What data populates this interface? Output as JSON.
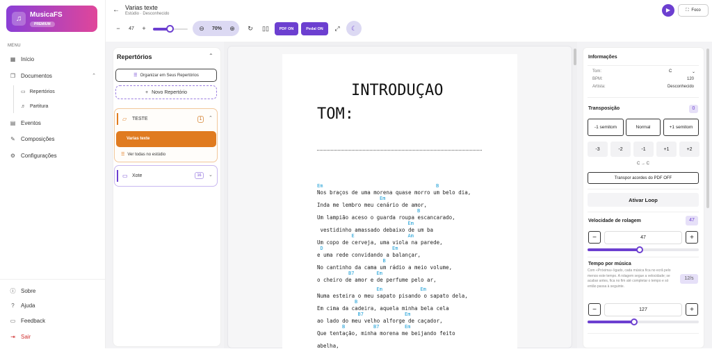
{
  "brand": {
    "name": "MusicaFS",
    "badge": "PREMIUM"
  },
  "sidebar": {
    "menu_label": "MENU",
    "items": [
      {
        "label": "Início",
        "icon": "grid-icon"
      },
      {
        "label": "Documentos",
        "icon": "documents-icon"
      },
      {
        "label": "Repertórios",
        "icon": "folder-icon"
      },
      {
        "label": "Partitura",
        "icon": "music-sheet-icon"
      },
      {
        "label": "Eventos",
        "icon": "calendar-icon"
      },
      {
        "label": "Composições",
        "icon": "compose-icon"
      },
      {
        "label": "Configurações",
        "icon": "gear-icon"
      }
    ],
    "bottom": [
      {
        "label": "Sobre",
        "icon": "info-icon"
      },
      {
        "label": "Ajuda",
        "icon": "help-icon"
      },
      {
        "label": "Feedback",
        "icon": "chat-icon"
      },
      {
        "label": "Sair",
        "icon": "logout-icon"
      }
    ]
  },
  "header": {
    "title": "Varias texte",
    "subtitle": "Estúdio · Desconhecido",
    "focus_label": "Foco"
  },
  "toolbar": {
    "font_size": "47",
    "font_size_level": 0.47,
    "zoom": "70%",
    "pdf_label": "PDF ON",
    "pedal_label": "Pedal ON"
  },
  "repertorios": {
    "title": "Repertórios",
    "organize_label": "Organizar em Seus Repertórios",
    "new_label": "Novo Repertório",
    "groups": [
      {
        "name": "TESTE",
        "count": "1",
        "songs": [
          "Varias texte"
        ],
        "see_all": "Ver todas no estúdio"
      },
      {
        "name": "Xote",
        "count": "16"
      }
    ]
  },
  "document": {
    "heading1": "INTRODUÇAO",
    "heading2": "TOM:",
    "lines": [
      {
        "chords": [
          {
            "t": "Em",
            "c": 0
          },
          {
            "t": "B",
            "c": 38
          }
        ],
        "text": "Nos braços de uma morena quase morro um belo dia,"
      },
      {
        "chords": [
          {
            "t": "Em",
            "c": 20
          }
        ],
        "text": "Inda me lembro meu cenário de amor,"
      },
      {
        "chords": [
          {
            "t": "B",
            "c": 32
          }
        ],
        "text": "Um lampião aceso o guarda roupa escancarado,"
      },
      {
        "chords": [
          {
            "t": "Em",
            "c": 29
          }
        ],
        "text": " vestidinho amassado debaixo de um ba"
      },
      {
        "chords": [
          {
            "t": "E",
            "c": 11
          },
          {
            "t": "Am",
            "c": 29
          }
        ],
        "text": "Um copo de cerveja, uma viola na parede,"
      },
      {
        "chords": [
          {
            "t": "D",
            "c": 1
          },
          {
            "t": "Em",
            "c": 24
          }
        ],
        "text": "e uma rede convidando a balançar,"
      },
      {
        "chords": [
          {
            "t": "B",
            "c": 21
          }
        ],
        "text": "No cantinho da cama um rádio a meio volume,"
      },
      {
        "chords": [
          {
            "t": "B7",
            "c": 10
          },
          {
            "t": "Em",
            "c": 19
          }
        ],
        "text": "o cheiro de amor e de perfume pelo ar,"
      },
      {
        "chords": [
          {
            "t": "Em",
            "c": 19
          },
          {
            "t": "Em",
            "c": 33
          }
        ],
        "text": "Numa esteira o meu sapato pisando o sapato dela,"
      },
      {
        "chords": [
          {
            "t": "B",
            "c": 12
          }
        ],
        "text": "Em cima da cadeira, aquela minha bela cela"
      },
      {
        "chords": [
          {
            "t": "B7",
            "c": 13
          },
          {
            "t": "Em",
            "c": 28
          }
        ],
        "text": "ao lado do meu velho alforge de caçador,"
      },
      {
        "chords": [
          {
            "t": "B",
            "c": 8
          },
          {
            "t": "B7",
            "c": 18
          },
          {
            "t": "Em",
            "c": 28
          }
        ],
        "text": "Que tentação, minha morena me beijando feito"
      },
      {
        "chords": [],
        "text": "abelha,"
      }
    ]
  },
  "info": {
    "title": "Informações",
    "rows": [
      {
        "label": "Tom:",
        "value": "C"
      },
      {
        "label": "BPM:",
        "value": "120"
      },
      {
        "label": "Artista:",
        "value": "Desconhecido"
      }
    ]
  },
  "transposicao": {
    "title": "Transposição",
    "value": "0",
    "minus_label": "-1 semitom",
    "normal_label": "Normal",
    "plus_label": "+1 semitom",
    "steps": [
      "-3",
      "-2",
      "-1",
      "+1",
      "+2"
    ],
    "result": "C → C",
    "pdf_chords_label": "Transpor acordes do PDF OFF"
  },
  "loop_label": "Ativar Loop",
  "scroll_speed": {
    "title": "Velocidade de rolagem",
    "badge": "47",
    "value": "47",
    "level": 0.47
  },
  "time_per_song": {
    "title": "Tempo por música",
    "description": "Com «Próxima» ligado, cada música fica no ecrã pelo menos este tempo. A rolagem segue a velocidade; se acabar antes, fica no fim até completar o tempo e só então passa à seguinte.",
    "badge": "12/s",
    "value": "127",
    "level": 0.42
  },
  "colors": {
    "accent": "#6c3fd0",
    "orange": "#e07b20",
    "chord": "#1e9fd6"
  }
}
